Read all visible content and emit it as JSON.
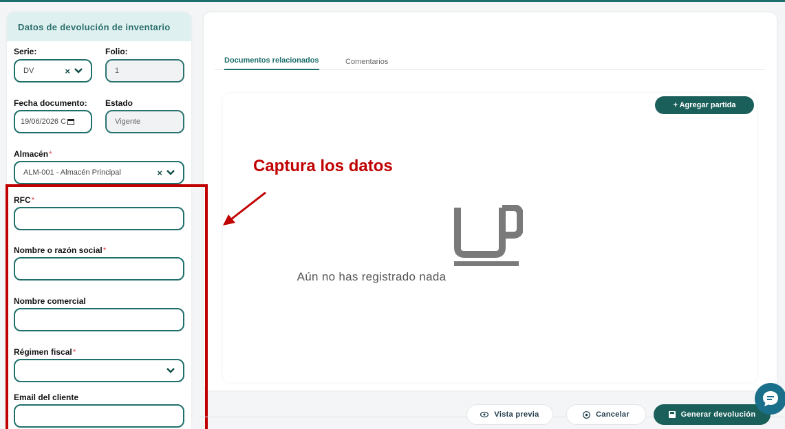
{
  "left": {
    "header": "Datos de devolución de inventario",
    "serie_label": "Serie:",
    "serie_value": "DV",
    "folio_label": "Folio:",
    "folio_value": "1",
    "fecha_label": "Fecha documento:",
    "fecha_value": "19/06/2026 C",
    "estado_label": "Estado",
    "estado_value": "Vigente",
    "almacen_label": "Almacén",
    "almacen_value": "ALM-001 - Almacén Principal",
    "rfc_label": "RFC",
    "nombre_label": "Nombre o razón social",
    "comercial_label": "Nombre comercial",
    "regimen_label": "Régimen fiscal",
    "email_label": "Email del cliente",
    "required_mark": "*",
    "clear_mark": "×"
  },
  "right": {
    "tab_docs": "Documentos relacionados",
    "tab_comments": "Comentarios",
    "add_button": "+ Agregar partida",
    "empty_text": "Aún no has registrado nada"
  },
  "annotation": {
    "text": "Captura los datos"
  },
  "footer": {
    "preview": "Vista previa",
    "cancel": "Cancelar",
    "generate": "Generar devolución"
  },
  "colors": {
    "accent": "#1e6f6b",
    "annotation": "#c00000",
    "required": "#e05353"
  },
  "icons": [
    "chevron-down-icon",
    "clear-icon",
    "calendar-icon",
    "mug-icon",
    "eye-icon",
    "cancel-circle-icon",
    "save-icon",
    "chat-icon",
    "arrow-icon"
  ]
}
